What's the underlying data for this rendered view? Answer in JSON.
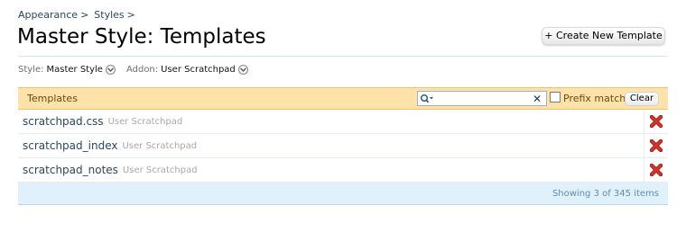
{
  "breadcrumb": {
    "items": [
      {
        "label": "Appearance"
      },
      {
        "label": "Styles"
      }
    ],
    "separator": ">"
  },
  "page": {
    "title": "Master Style: Templates"
  },
  "actions": {
    "create_label": "+ Create New Template"
  },
  "filters": {
    "style": {
      "label": "Style:",
      "value": "Master Style"
    },
    "addon": {
      "label": "Addon:",
      "value": "User Scratchpad"
    }
  },
  "list": {
    "heading": "Templates",
    "search": {
      "value": "",
      "placeholder": ""
    },
    "prefix_match_label": "Prefix match",
    "clear_label": "Clear",
    "rows": [
      {
        "name": "scratchpad.css",
        "addon": "User Scratchpad"
      },
      {
        "name": "scratchpad_index",
        "addon": "User Scratchpad"
      },
      {
        "name": "scratchpad_notes",
        "addon": "User Scratchpad"
      }
    ],
    "summary": "Showing 3 of 345 items"
  },
  "icons": {
    "search": "search-icon",
    "clear": "close-icon",
    "delete": "delete-icon",
    "chevron": "chevron-down-icon"
  },
  "colors": {
    "link": "#2b485c",
    "header_bg": "#ffe2aa",
    "footer_bg": "#e1f1fc",
    "delete_red": "#d9322b"
  }
}
